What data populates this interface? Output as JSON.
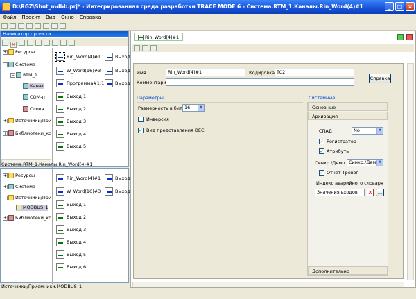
{
  "window": {
    "title": "D:\\RGZ\\Shut_mdbb.prj* - Интегрированная среда разработки TRACE MODE 6 - Система.RTM_1.Каналы.Rin_Word(4)#1"
  },
  "menu": [
    "Файл",
    "Проект",
    "Вид",
    "Окно",
    "Справка"
  ],
  "navigator": {
    "title": "Навигатор проекта",
    "tree": [
      "Ресурсы",
      "Система",
      "RTM_1",
      "Канал",
      "COM-п",
      "Слова",
      "Источники/При",
      "Библиотеки_ко"
    ],
    "grid": [
      [
        "Rin_Word(4)#1",
        "Выход"
      ],
      [
        "W_Word(16)#3",
        "Выход"
      ],
      [
        "Программа#1:1",
        "Выход"
      ],
      [
        "Выход 1",
        ""
      ],
      [
        "Выход 2",
        ""
      ],
      [
        "Выход 3",
        ""
      ],
      [
        "Выход 4",
        ""
      ],
      [
        "Выход 5",
        ""
      ]
    ],
    "path": "Система.RTM_1.Каналы.Rin_Word(4)#1"
  },
  "lower": {
    "tree": [
      "Ресурсы",
      "Система",
      "Источники/При",
      "MODBUS_1",
      "Библиотеки_ко"
    ],
    "grid": [
      [
        "Rin_Word(4)#1",
        "Выход"
      ],
      [
        "W_Word(16)#3",
        "Выход"
      ],
      [
        "Выход 1",
        ""
      ],
      [
        "Выход 2",
        ""
      ],
      [
        "Выход 3",
        ""
      ],
      [
        "Выход 4",
        ""
      ],
      [
        "Выход 5",
        ""
      ],
      [
        "Выход 6",
        ""
      ]
    ],
    "status": "Источники/Приемники.MODBUS_1"
  },
  "editor": {
    "tab": "Rin_Word(4)#1",
    "name_label": "Имя",
    "name_value": "Rin_Word(4)#1",
    "encoding_label": "Кодировка",
    "encoding_value": "TC2",
    "comment_label": "Комментарий",
    "comment_value": "",
    "help_button": "Справка",
    "params_title": "Параметры",
    "bitsize_label": "Размерность в битах",
    "bitsize_value": "16",
    "inversion_label": "Инверсия",
    "inversion_checked": false,
    "dec_label": "Вид представления DEC",
    "dec_checked": true,
    "system_title": "Системные",
    "tab_basic": "Основные",
    "tab_archive": "Архивация",
    "spad_label": "СПАД",
    "spad_value": "No",
    "registrator_label": "Регистратор",
    "registrator_checked": true,
    "attrs_label": "Атрибуты",
    "attrs_checked": true,
    "sync_label": "Синхр./Демп",
    "sync_value": "Синхр./Демп",
    "alarm_label": "Отчет Тревог",
    "alarm_checked": true,
    "dict_label": "Индекс аварийного словаря",
    "dict_value": "Значения входов",
    "extra_button": "Дополнительно"
  }
}
